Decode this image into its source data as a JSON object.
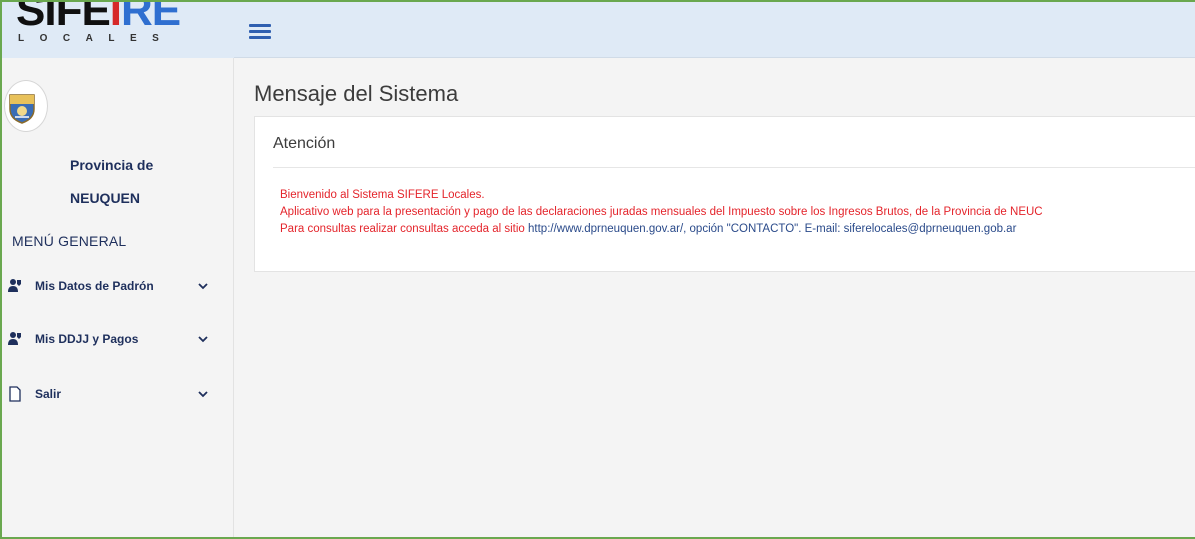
{
  "logo": {
    "word_dark": "SIFE",
    "word_red": "I",
    "word_blue": "RE",
    "subtitle": "LOCALES"
  },
  "profile": {
    "province_line1": "Provincia de",
    "province_line2": "NEUQUEN"
  },
  "sidebar": {
    "menu_title": "MENÚ GENERAL",
    "items": [
      {
        "label": "Mis Datos de Padrón",
        "icon": "user-pin-icon"
      },
      {
        "label": "Mis DDJJ y Pagos",
        "icon": "user-pin-icon"
      },
      {
        "label": "Salir",
        "icon": "document-icon"
      }
    ]
  },
  "main": {
    "title": "Mensaje del Sistema",
    "panel": {
      "heading": "Atención",
      "line1": "Bienvenido al Sistema SIFERE Locales.",
      "line2": "Aplicativo web para la presentación y pago de las declaraciones juradas mensuales del Impuesto sobre los Ingresos Brutos, de la Provincia de NEUC",
      "line3_prefix": "Para consultas realizar consultas acceda al sitio ",
      "line3_link": "http://www.dprneuquen.gov.ar/, opción \"CONTACTO\". E-mail: siferelocales@dprneuquen.gob.ar"
    }
  },
  "colors": {
    "accent": "#2f6fd0",
    "message": "#e4242b",
    "topbar": "#dfeaf6",
    "frame": "#6aa84f"
  }
}
